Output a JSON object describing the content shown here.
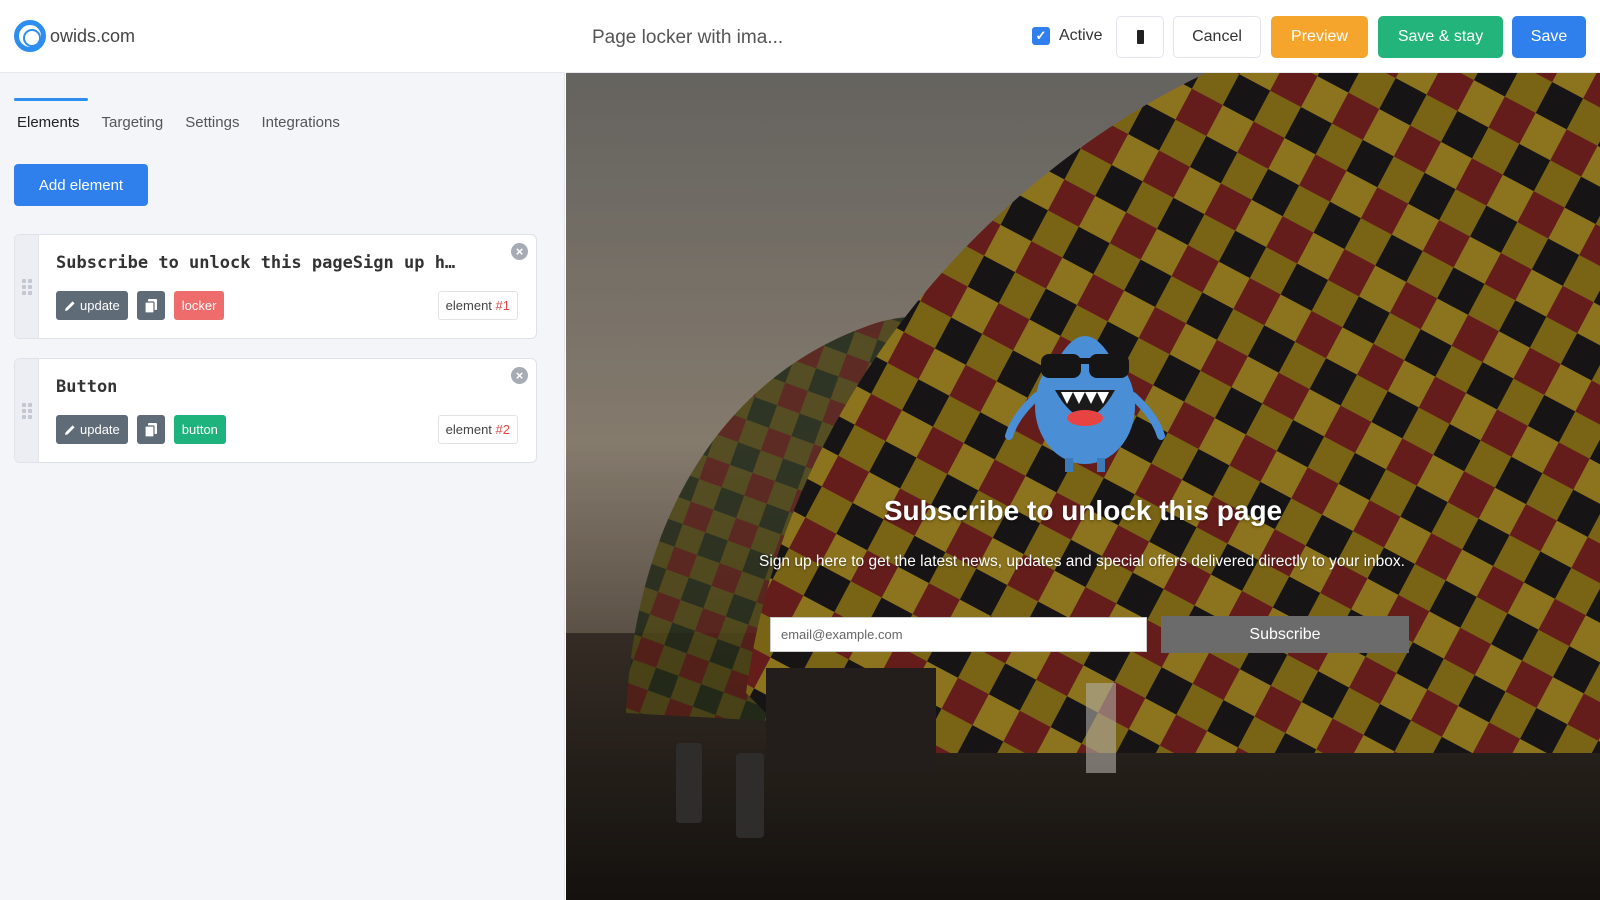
{
  "brand": {
    "name": "owids.com"
  },
  "tabs": [
    {
      "label": "Elements"
    },
    {
      "label": "Targeting"
    },
    {
      "label": "Settings"
    },
    {
      "label": "Integrations"
    }
  ],
  "add_element_label": "Add element",
  "elements": [
    {
      "title": "Subscribe to unlock this pageSign up h…",
      "update_label": "update",
      "type_label": "locker",
      "tag_prefix": "element ",
      "tag_num": "#1"
    },
    {
      "title": "Button",
      "update_label": "update",
      "type_label": "button",
      "tag_prefix": "element ",
      "tag_num": "#2"
    }
  ],
  "topbar": {
    "page_title": "Page locker with ima...",
    "active_label": "Active",
    "cancel_label": "Cancel",
    "preview_label": "Preview",
    "save_stay_label": "Save & stay",
    "save_label": "Save"
  },
  "locker": {
    "title": "Subscribe to unlock this page",
    "text": "Sign up here to get the latest news, updates and special offers delivered directly to your inbox.",
    "email_placeholder": "email@example.com",
    "subscribe_label": "Subscribe"
  },
  "colors": {
    "primary": "#2f80ed",
    "preview": "#f5a42c",
    "save_stay": "#22b47a",
    "locker_tag": "#ee6c6c",
    "button_tag": "#1eb27c"
  },
  "icons": [
    "logo-icon",
    "drag-handle-icon",
    "close-icon",
    "pencil-icon",
    "copy-icon",
    "checkbox-checked-icon",
    "mobile-icon",
    "mascot-image"
  ]
}
